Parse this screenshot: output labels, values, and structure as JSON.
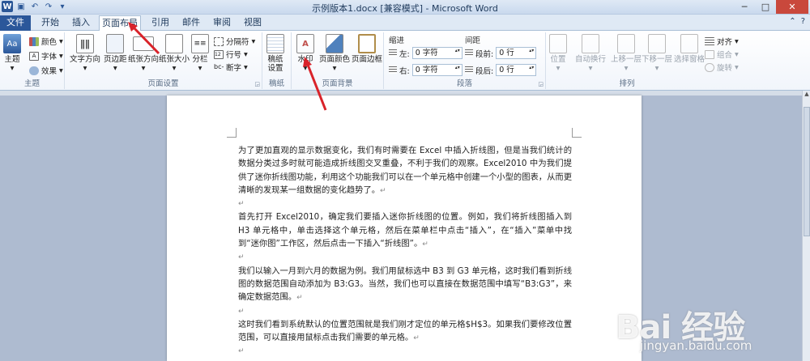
{
  "window": {
    "title": "示例版本1.docx [兼容模式] - Microsoft Word"
  },
  "tabs": [
    {
      "label": "文件"
    },
    {
      "label": "开始"
    },
    {
      "label": "插入"
    },
    {
      "label": "页面布局"
    },
    {
      "label": "引用"
    },
    {
      "label": "邮件"
    },
    {
      "label": "审阅"
    },
    {
      "label": "视图"
    }
  ],
  "ribbon": {
    "theme": {
      "themes_label": "主题",
      "colors_label": "颜色",
      "fonts_label": "字体",
      "effects_label": "效果",
      "group_label": "主题"
    },
    "page_setup": {
      "text_direction": "文字方向",
      "margins": "页边距",
      "orientation": "纸张方向",
      "size": "纸张大小",
      "columns": "分栏",
      "breaks": "分隔符",
      "line_numbers": "行号",
      "hyphenation": "断字",
      "group_label": "页面设置"
    },
    "draft": {
      "draft_setup": "稿纸\n设置",
      "group_label": "稿纸"
    },
    "background": {
      "watermark": "水印",
      "page_color": "页面颜色",
      "page_borders": "页面边框",
      "group_label": "页面背景"
    },
    "paragraph": {
      "indent_head": "缩进",
      "spacing_head": "间距",
      "left_label": "左:",
      "left_value": "0 字符",
      "right_label": "右:",
      "right_value": "0 字符",
      "before_label": "段前:",
      "before_value": "0 行",
      "after_label": "段后:",
      "after_value": "0 行",
      "group_label": "段落"
    },
    "arrange": {
      "position": "位置",
      "wrap_text": "自动换行",
      "bring_forward": "上移一层",
      "send_backward": "下移一层",
      "selection_pane": "选择窗格",
      "align": "对齐",
      "group": "组合",
      "rotate": "旋转",
      "group_label": "排列"
    }
  },
  "document": {
    "paragraphs": [
      "为了更加直观的显示数据变化，我们有时需要在 Excel 中插入折线图，但是当我们统计的数据分类过多时就可能造成折线图交叉重叠，不利于我们的观察。Excel2010 中为我们提供了迷你折线图功能，利用这个功能我们可以在一个单元格中创建一个小型的图表，从而更清晰的发现某一组数据的变化趋势了。",
      "",
      "首先打开 Excel2010，确定我们要插入迷你折线图的位置。例如，我们将折线图插入到 H3 单元格中，单击选择这个单元格，然后在菜单栏中点击“插入”，在“插入”菜单中找到“迷你图”工作区，然后点击一下插入“折线图”。",
      "",
      "我们以输入一月到六月的数据为例。我们用鼠标选中 B3 到 G3 单元格，这时我们看到折线图的数据范围自动添加为 B3:G3。当然，我们也可以直接在数据范围中填写“B3:G3”，来确定数据范围。",
      "",
      "这时我们看到系统默认的位置范围就是我们刚才定位的单元格$H$3。如果我们要修改位置范围，可以直接用鼠标点击我们需要的单元格。",
      "",
      ""
    ],
    "paragraph_mark": "↵"
  },
  "watermark": {
    "logo": "Bai 经验",
    "url": "jingyan.baidu.com"
  },
  "colors": {
    "accent": "#2b579a",
    "arrow": "#d9232a"
  }
}
